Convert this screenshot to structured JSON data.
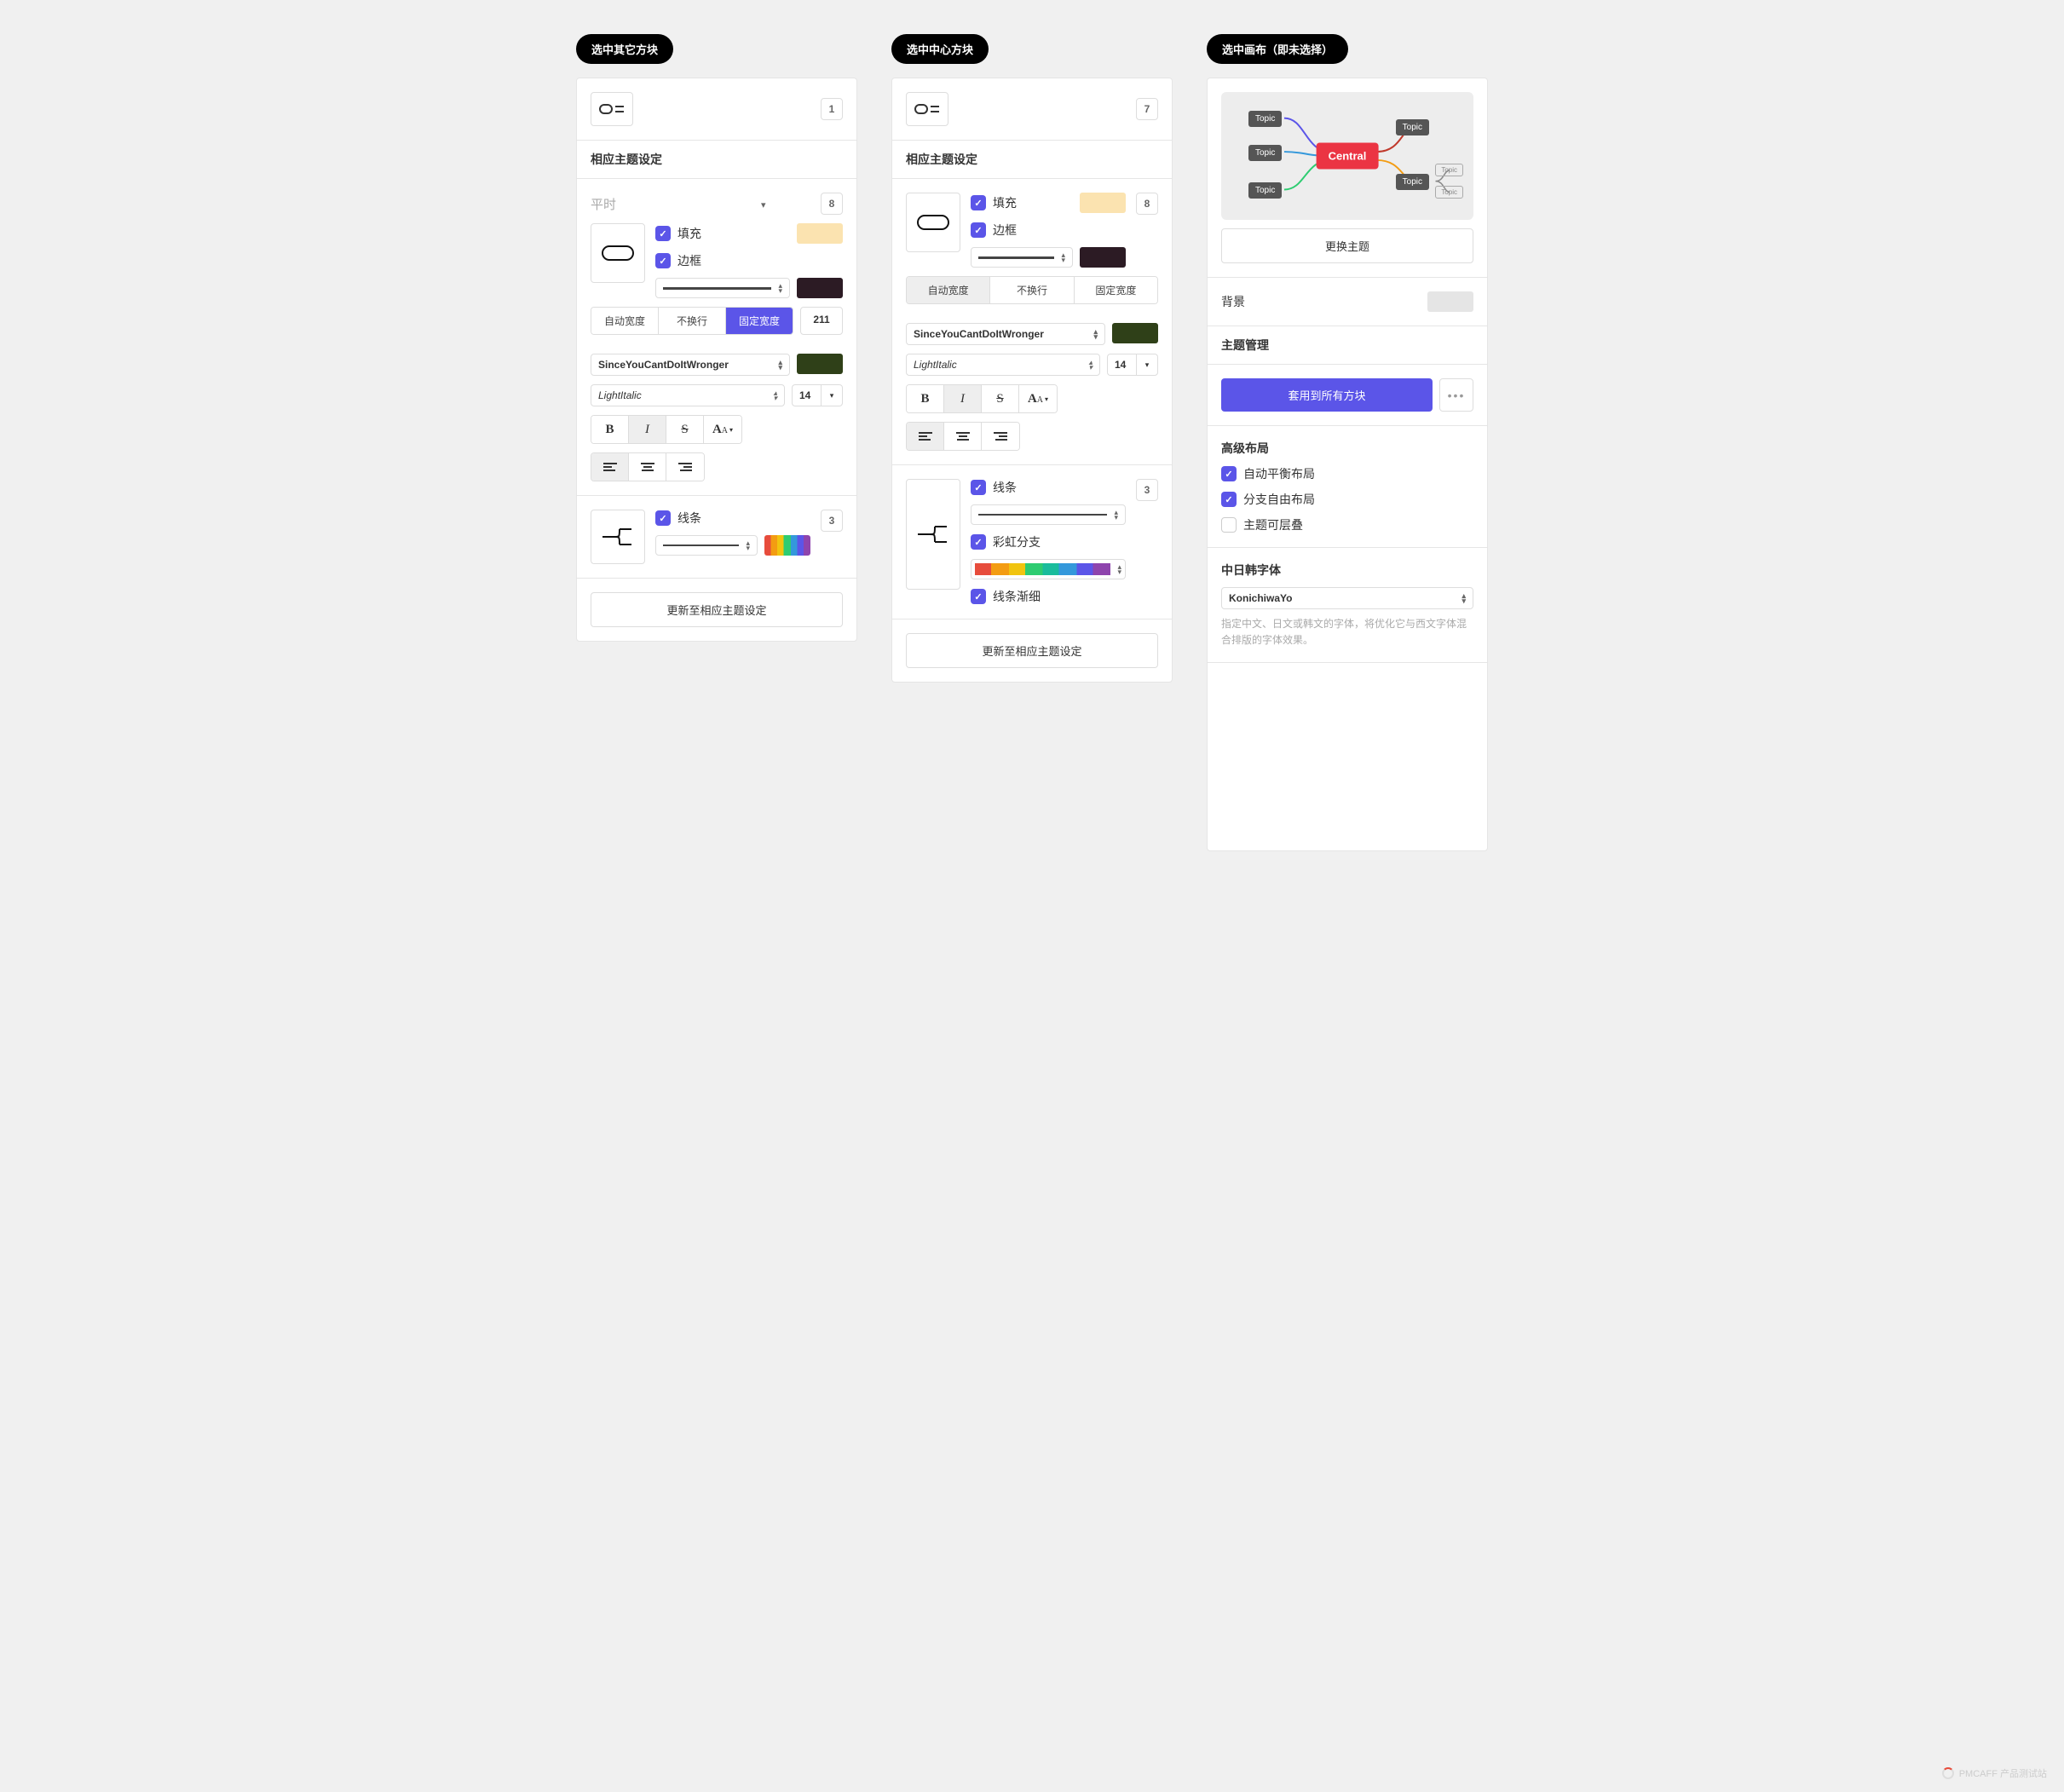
{
  "columns": {
    "col1_label": "选中其它方块",
    "col2_label": "选中中心方块",
    "col3_label": "选中画布（即未选择）"
  },
  "col1": {
    "structure_badge": "1",
    "section_title": "相应主题设定",
    "state_label": "平时",
    "state_badge": "8",
    "fill_label": "填充",
    "fill_color": "#fbe3b0",
    "border_label": "边框",
    "border_color": "#2c1b24",
    "seg_auto": "自动宽度",
    "seg_nowrap": "不换行",
    "seg_fixed": "固定宽度",
    "width_value": "211",
    "font_family": "SinceYouCantDoItWronger",
    "font_color": "#2f4018",
    "font_weight": "LightItalic",
    "font_size": "14",
    "line_label": "线条",
    "line_badge": "3",
    "update_btn": "更新至相应主题设定"
  },
  "col2": {
    "structure_badge": "7",
    "section_title": "相应主题设定",
    "fill_label": "填充",
    "fill_color": "#fbe3b0",
    "border_label": "边框",
    "border_color": "#2c1b24",
    "badge_8": "8",
    "seg_auto": "自动宽度",
    "seg_nowrap": "不换行",
    "seg_fixed": "固定宽度",
    "font_family": "SinceYouCantDoItWronger",
    "font_color": "#2f4018",
    "font_weight": "LightItalic",
    "font_size": "14",
    "line_label": "线条",
    "line_badge": "3",
    "rainbow_label": "彩虹分支",
    "taper_label": "线条渐细",
    "update_btn": "更新至相应主题设定"
  },
  "col3": {
    "central_label": "Central",
    "topic_label": "Topic",
    "change_theme_btn": "更换主题",
    "background_title": "背景",
    "bg_swatch": "#e5e5e5",
    "theme_mgmt_title": "主题管理",
    "apply_all_btn": "套用到所有方块",
    "adv_layout_title": "高级布局",
    "auto_balance": "自动平衡布局",
    "branch_free": "分支自由布局",
    "theme_stack": "主题可层叠",
    "cjk_title": "中日韩字体",
    "cjk_font": "KonichiwaYo",
    "cjk_note": "指定中文、日文或韩文的字体，将优化它与西文字体混合排版的字体效果。"
  },
  "watermark": "PMCAFF 产品测试站"
}
